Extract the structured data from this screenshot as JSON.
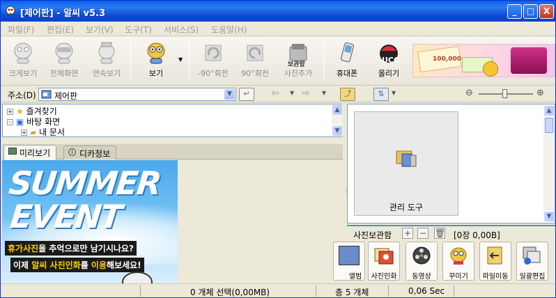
{
  "window": {
    "title": "[제어판] - 알씨 v5.3"
  },
  "titlebar_buttons": {
    "min": "_",
    "max": "□",
    "close": "X"
  },
  "menu": [
    "파일(F)",
    "편집(E)",
    "보기(V)",
    "도구(T)",
    "서비스(S)",
    "도움말(H)"
  ],
  "toolbar": {
    "items": [
      {
        "label": "크게보기",
        "icon": "magnify-mascot-icon",
        "enabled": false
      },
      {
        "label": "전체화면",
        "icon": "fullscreen-mascot-icon",
        "enabled": false
      },
      {
        "label": "연속보기",
        "icon": "slideshow-mascot-icon",
        "enabled": false
      },
      {
        "label": "보기",
        "icon": "view-mascot-icon",
        "enabled": true
      },
      {
        "label": "-90°회전",
        "icon": "rotate-left-icon",
        "enabled": false
      },
      {
        "label": "90°회전",
        "icon": "rotate-right-icon",
        "enabled": false
      },
      {
        "label": "사진추가",
        "icon": "photo-storage-icon",
        "enabled": false,
        "badge": "보관함"
      },
      {
        "label": "휴대폰",
        "icon": "mobile-phone-icon",
        "enabled": true
      },
      {
        "label": "올리기",
        "icon": "ucc-upload-icon",
        "enabled": true,
        "badge": "UCC"
      }
    ],
    "banner": {
      "text": "100,000"
    }
  },
  "address": {
    "label": "주소(D)",
    "value": "제어판"
  },
  "zoom": {
    "minus": "⊖",
    "plus": "⊕",
    "level": 0.5
  },
  "tree": [
    {
      "label": "즐겨찾기",
      "icon": "star-icon",
      "toggle": "+"
    },
    {
      "label": "바탕 화면",
      "icon": "desktop-icon",
      "toggle": "-"
    },
    {
      "label": "내 문서",
      "icon": "folder-icon",
      "toggle": "+"
    }
  ],
  "tabs": [
    {
      "label": "미리보기"
    },
    {
      "label": "디카정보"
    }
  ],
  "preview": {
    "line1": "SUMMER",
    "line2": "EVENT",
    "caption1_hl": "휴가사진",
    "caption1_rest": "을 추억으로만 남기시나요?",
    "caption2_a": "이제 ",
    "caption2_hl1": "알씨 사진인화",
    "caption2_b": "를 ",
    "caption2_hl2": "이용",
    "caption2_c": "해보세요!"
  },
  "thumbnail": {
    "label": "관리 도구"
  },
  "storage": {
    "label": "사진보관함",
    "add": "+",
    "remove": "−",
    "count": "[0장 0,00B]"
  },
  "actions": [
    {
      "label": "앨범",
      "icon": "album-icon"
    },
    {
      "label": "사진인화",
      "icon": "photo-print-icon"
    },
    {
      "label": "동영상",
      "icon": "film-reel-icon"
    },
    {
      "label": "꾸미기",
      "icon": "decorate-mascot-icon"
    },
    {
      "label": "파일이동",
      "icon": "file-move-icon"
    },
    {
      "label": "일괄편집",
      "icon": "batch-edit-icon"
    }
  ],
  "status": {
    "selected": "0 개체 선택(0,00MB)",
    "total": "총 5 개체",
    "time": "0,06 Sec"
  }
}
